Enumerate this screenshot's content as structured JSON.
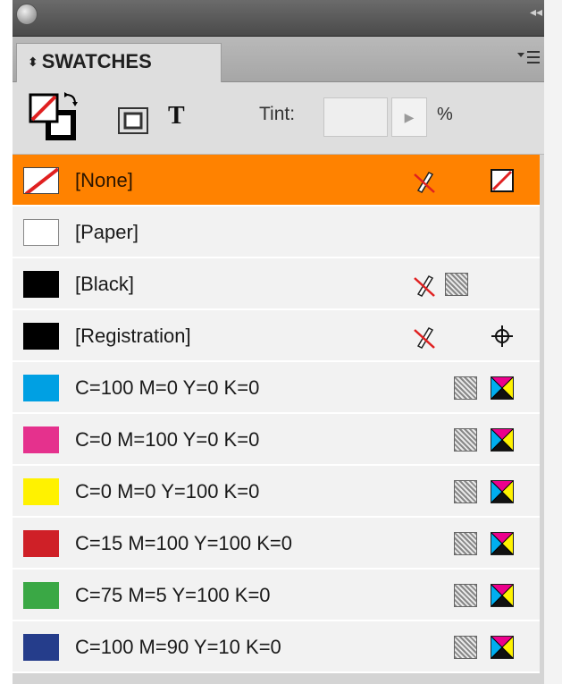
{
  "panel": {
    "tab_label": "SWATCHES",
    "tint_label": "Tint:",
    "tint_value": "",
    "percent_symbol": "%",
    "text_button_label": "T"
  },
  "swatches": [
    {
      "name": "[None]",
      "color": "none",
      "selected": true,
      "icons": [
        "no-edit-pencil-icon",
        "none-swatch-icon"
      ]
    },
    {
      "name": "[Paper]",
      "color": "#ffffff",
      "selected": false,
      "icons": []
    },
    {
      "name": "[Black]",
      "color": "#000000",
      "selected": false,
      "icons": [
        "no-edit-pencil-icon",
        "process-color-icon"
      ]
    },
    {
      "name": "[Registration]",
      "color": "#000000",
      "selected": false,
      "icons": [
        "no-edit-pencil-icon",
        "registration-target-icon"
      ]
    },
    {
      "name": "C=100 M=0 Y=0 K=0",
      "color": "#00a0e3",
      "selected": false,
      "icons": [
        "process-color-icon",
        "cmyk-mode-icon"
      ]
    },
    {
      "name": "C=0 M=100 Y=0 K=0",
      "color": "#e5318d",
      "selected": false,
      "icons": [
        "process-color-icon",
        "cmyk-mode-icon"
      ]
    },
    {
      "name": "C=0 M=0 Y=100 K=0",
      "color": "#fff200",
      "selected": false,
      "icons": [
        "process-color-icon",
        "cmyk-mode-icon"
      ]
    },
    {
      "name": "C=15 M=100 Y=100 K=0",
      "color": "#cf2027",
      "selected": false,
      "icons": [
        "process-color-icon",
        "cmyk-mode-icon"
      ]
    },
    {
      "name": "C=75 M=5 Y=100 K=0",
      "color": "#3aa845",
      "selected": false,
      "icons": [
        "process-color-icon",
        "cmyk-mode-icon"
      ]
    },
    {
      "name": "C=100 M=90 Y=10 K=0",
      "color": "#253d8b",
      "selected": false,
      "icons": [
        "process-color-icon",
        "cmyk-mode-icon"
      ]
    }
  ],
  "colors": {
    "selection": "#ff8200",
    "row_bg": "#f2f2f2",
    "panel_bg": "#dedede"
  }
}
